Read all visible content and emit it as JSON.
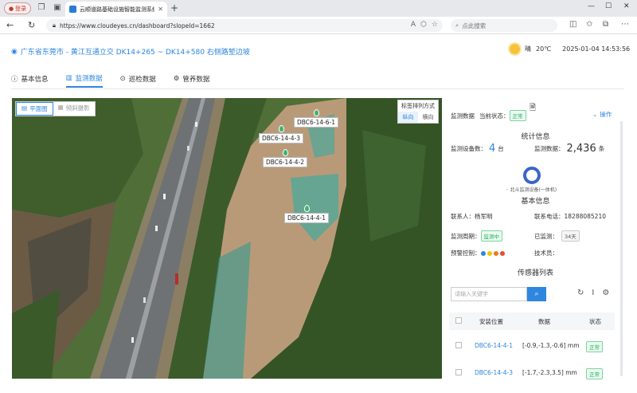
{
  "browser": {
    "login_label": "登录",
    "tab_title": "云顺道路基础设施智能监测系统",
    "url": "https://www.cloudeyes.cn/dashboard?slopeId=1662",
    "search_placeholder": "点此搜索"
  },
  "header": {
    "title": "广东省东莞市 - 黄江互通立交 DK14+265 ~ DK14+580 右侧路堑边坡",
    "weather": "晴",
    "temperature": "20℃",
    "datetime": "2025-01-04 14:53:56"
  },
  "tabs": [
    {
      "label": "基本信息",
      "icon": "info-circle-icon"
    },
    {
      "label": "监测数据",
      "icon": "chart-bar-icon"
    },
    {
      "label": "巡检数据",
      "icon": "location-pin-icon"
    },
    {
      "label": "管养数据",
      "icon": "gear-icon"
    }
  ],
  "map": {
    "view_plane": "平面图",
    "view_3d": "倾斜摄影",
    "label_sort_title": "标签排列方式",
    "sort_horizontal": "纵向",
    "sort_vertical": "横向",
    "markers": [
      "DBC6-14-6-1",
      "DBC6-14-4-3",
      "DBC6-14-4-2",
      "DBC6-14-4-1"
    ]
  },
  "panel": {
    "monitoring_label": "监测数据",
    "current_status_label": "当前状态：",
    "current_status": "正常",
    "operate_label": "操作",
    "stats_title": "统计信息",
    "device_count_label": "监测设备数：",
    "device_count": "4",
    "device_unit": "台",
    "data_count_label": "监测数据：",
    "data_count": "2,436",
    "data_unit": "条",
    "device_type": "北斗监测设备(一体机)",
    "basic_title": "基本信息",
    "contact_label": "联系人：",
    "contact": "杨军明",
    "phone_label": "联系电话：",
    "phone": "18288085210",
    "period_label": "监测周期：",
    "period": "监测中",
    "monitored_label": "已监测：",
    "monitored": "34天",
    "alarm_label": "预警控制：",
    "tech_label": "技术员：",
    "alarm_colors": [
      "#2e86de",
      "#f1c40f",
      "#e67e22",
      "#e74c3c"
    ],
    "sensor_title": "传感器列表",
    "search_placeholder": "请输入关键字",
    "columns": [
      "安装位置",
      "数据",
      "状态"
    ],
    "rows": [
      {
        "location": "DBC6-14-4-1",
        "data": "[-0.9,-1.3,-0.6] mm",
        "status": "正常"
      },
      {
        "location": "DBC6-14-4-3",
        "data": "[-1.7,-2.3,3.5] mm",
        "status": "正常"
      }
    ]
  }
}
